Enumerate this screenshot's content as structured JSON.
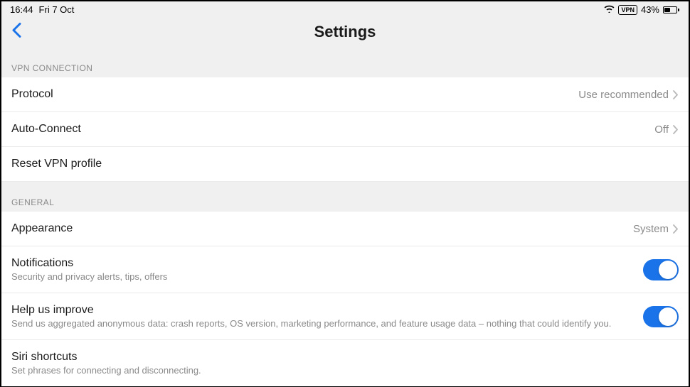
{
  "status_bar": {
    "time": "16:44",
    "date": "Fri 7 Oct",
    "vpn_badge": "VPN",
    "battery_percent": "43%"
  },
  "header": {
    "title": "Settings"
  },
  "sections": {
    "vpn_connection": {
      "label": "VPN CONNECTION",
      "protocol": {
        "title": "Protocol",
        "value": "Use recommended"
      },
      "auto_connect": {
        "title": "Auto-Connect",
        "value": "Off"
      },
      "reset": {
        "title": "Reset VPN profile"
      }
    },
    "general": {
      "label": "GENERAL",
      "appearance": {
        "title": "Appearance",
        "value": "System"
      },
      "notifications": {
        "title": "Notifications",
        "subtitle": "Security and privacy alerts, tips, offers",
        "enabled": true
      },
      "help_improve": {
        "title": "Help us improve",
        "subtitle": "Send us aggregated anonymous data: crash reports, OS version, marketing performance, and feature usage data  – nothing that could identify you.",
        "enabled": true
      },
      "siri": {
        "title": "Siri shortcuts",
        "subtitle": "Set phrases for connecting and disconnecting."
      }
    }
  },
  "colors": {
    "accent": "#1a73e8",
    "muted": "#8a8a8a",
    "section_bg": "#f0f0f0"
  }
}
